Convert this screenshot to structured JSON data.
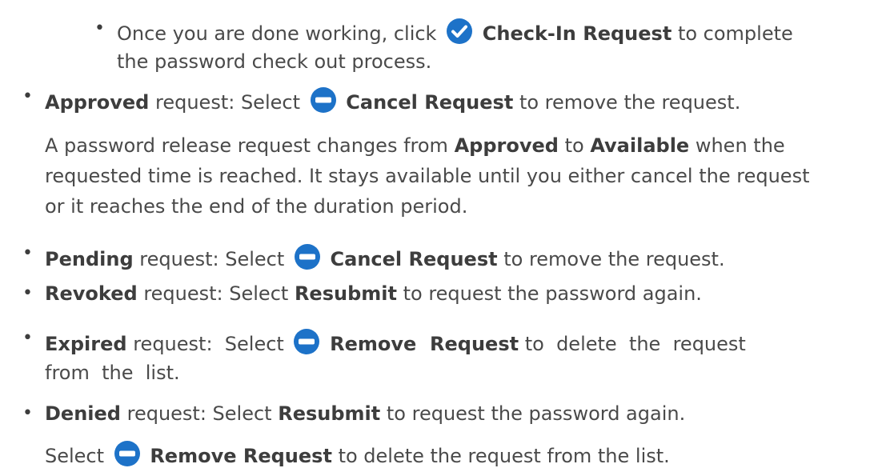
{
  "colors": {
    "text": "#4a4a4a",
    "bold": "#3d3d3d",
    "icon_blue": "#1d72c8"
  },
  "checkin_item": {
    "prefix": "Once you are done working, click",
    "icon": "checkmark-circle-icon",
    "action": "Check-In Request",
    "suffix_line1": "to complete",
    "line2": "the password check out process."
  },
  "approved": {
    "status": "Approved",
    "text1": "request: Select",
    "icon": "minus-circle-icon",
    "action": "Cancel Request",
    "text2": "to remove the request."
  },
  "approved_note": {
    "line1_a": "A password release request changes from",
    "line1_b": "Approved",
    "line1_c": "to",
    "line1_d": "Available",
    "line1_e": "when the",
    "line2": "requested time is reached. It stays available until you either cancel the request",
    "line3": "or it reaches the end of the duration period."
  },
  "pending": {
    "status": "Pending",
    "text1": "request: Select",
    "icon": "minus-circle-icon",
    "action": "Cancel Request",
    "text2": "to remove the request."
  },
  "revoked": {
    "status": "Revoked",
    "text1": "request: Select",
    "action": "Resubmit",
    "text2": "to request the password again."
  },
  "expired": {
    "status": "Expired",
    "text1": "request:  Select",
    "icon": "minus-circle-icon",
    "action": "Remove  Request",
    "text2": "to  delete  the  request",
    "line2": "from  the  list."
  },
  "denied": {
    "status": "Denied",
    "text1": "request: Select",
    "action": "Resubmit",
    "text2": "to request the password again."
  },
  "denied_note": {
    "text1": "Select",
    "icon": "minus-circle-icon",
    "action": "Remove Request",
    "text2": "to delete the request from the list."
  }
}
